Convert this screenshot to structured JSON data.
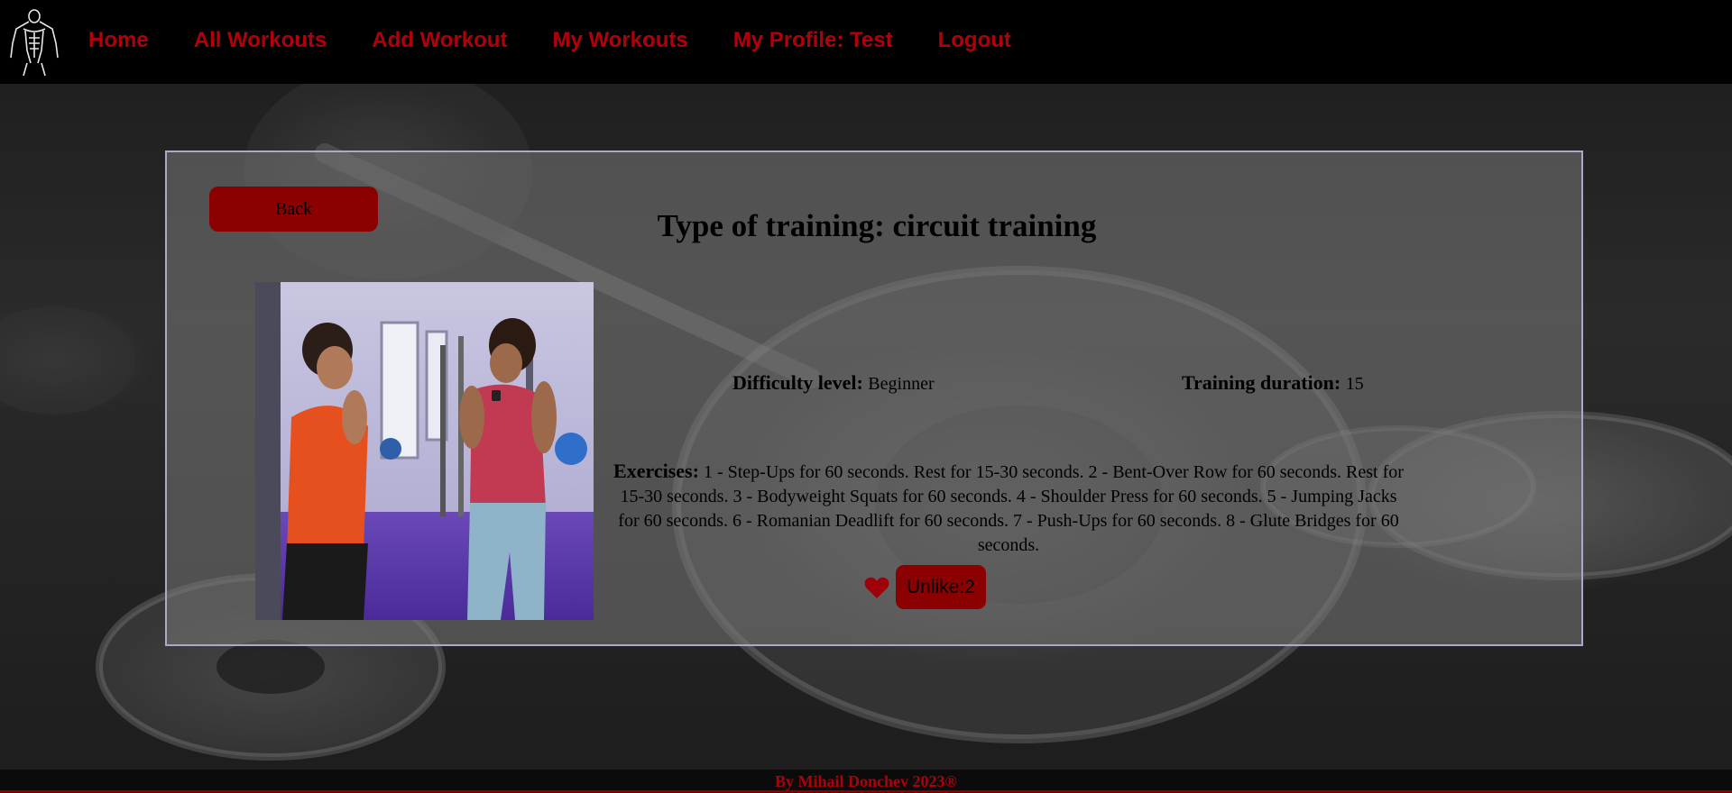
{
  "nav": {
    "logo_icon": "bodybuilder-logo-icon",
    "links": [
      {
        "label": "Home"
      },
      {
        "label": "All Workouts"
      },
      {
        "label": "Add Workout"
      },
      {
        "label": "My Workouts"
      },
      {
        "label": "My Profile: Test"
      },
      {
        "label": "Logout"
      }
    ]
  },
  "workout": {
    "back_label": "Back",
    "title": "Type of training: circuit training",
    "image_icon": "workout-photo",
    "difficulty_label": "Difficulty level:",
    "difficulty_value": "Beginner",
    "duration_label": "Training duration:",
    "duration_value": "15",
    "exercises_label": "Exercises:",
    "exercises_value": "1 - Step-Ups for 60 seconds. Rest for 15-30 seconds. 2 - Bent-Over Row for 60 seconds. Rest for 15-30 seconds. 3 - Bodyweight Squats for 60 seconds. 4 - Shoulder Press for 60 seconds. 5 - Jumping Jacks for 60 seconds. 6 - Romanian Deadlift for 60 seconds. 7 - Push-Ups for 60 seconds. 8 - Glute Bridges for 60 seconds.",
    "like_icon": "heart-icon",
    "unlike_label": "Unlike:2"
  },
  "footer": {
    "text": "By Mihail Donchev 2023®"
  },
  "colors": {
    "accent": "#b0000a",
    "button": "#8b0000",
    "navbar": "#000000"
  }
}
